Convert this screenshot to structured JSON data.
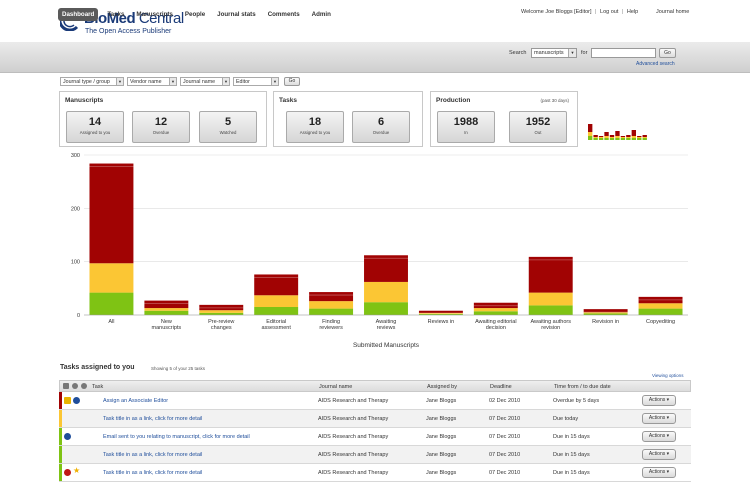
{
  "header": {
    "brand_bold": "BioMed",
    "brand_light": " Central",
    "tagline": "The Open Access Publisher",
    "welcome": "Welcome Joe Bloggs [Editor]",
    "logout": "Log out",
    "help": "Help",
    "separator": "|",
    "journal_home": "Journal home"
  },
  "nav": {
    "items": [
      "Dashboard",
      "Tasks",
      "Manuscripts",
      "People",
      "Journal stats",
      "Comments",
      "Admin"
    ],
    "active": "Dashboard"
  },
  "search": {
    "label": "Search",
    "scope": "manuscripts",
    "for_label": "for",
    "query": "",
    "go": "Go",
    "advanced": "Advanced search"
  },
  "filters": {
    "items": [
      "Journal type / group",
      "Vendor name",
      "Journal name",
      "Editor"
    ],
    "go": "Go"
  },
  "panels": {
    "manuscripts": {
      "title": "Manuscripts",
      "stats": [
        {
          "value": "14",
          "label": "Assigned to you"
        },
        {
          "value": "12",
          "label": "Overdue"
        },
        {
          "value": "5",
          "label": "Watched"
        }
      ]
    },
    "tasks": {
      "title": "Tasks",
      "stats": [
        {
          "value": "18",
          "label": "Assigned to you"
        },
        {
          "value": "6",
          "label": "Overdue"
        }
      ]
    },
    "production": {
      "title": "Production",
      "note": "(past 30 days)",
      "stats": [
        {
          "value": "1988",
          "label": "In"
        },
        {
          "value": "1952",
          "label": "Out"
        }
      ]
    }
  },
  "colors": {
    "red": "#a10303",
    "yellow": "#fbc634",
    "green": "#7fc314"
  },
  "chart_data": {
    "type": "bar",
    "stacked": true,
    "xlabel": "Submitted Manuscripts",
    "ylim": [
      0,
      300
    ],
    "yticks": [
      0,
      100,
      200,
      300
    ],
    "grid": true,
    "categories": [
      "All",
      "New manuscripts",
      "Pre-review changes",
      "Editorial assessment",
      "Finding reviewers",
      "Awaiting reviews",
      "Reviews in",
      "Awaiting editorial decision",
      "Awaiting authors revision",
      "Revision in",
      "Copyediting"
    ],
    "series": [
      {
        "color": "#7fc314",
        "values": [
          42,
          8,
          4,
          15,
          12,
          24,
          2,
          7,
          18,
          3,
          12
        ]
      },
      {
        "color": "#fbc634",
        "values": [
          55,
          5,
          5,
          22,
          14,
          38,
          2,
          6,
          24,
          2,
          10
        ]
      },
      {
        "color": "#a10303",
        "values": [
          187,
          14,
          10,
          39,
          17,
          50,
          4,
          10,
          67,
          6,
          12
        ]
      }
    ]
  },
  "sparkline_data": {
    "type": "bar",
    "stacked": true,
    "series": [
      {
        "color": "#7fc314",
        "values": [
          4,
          2,
          2,
          2,
          2,
          2,
          2,
          2,
          2,
          2,
          2
        ]
      },
      {
        "color": "#fbc634",
        "values": [
          4,
          1,
          1,
          2,
          1,
          2,
          1,
          1,
          2,
          1,
          1
        ]
      },
      {
        "color": "#a10303",
        "values": [
          8,
          2,
          1,
          4,
          2,
          5,
          1,
          2,
          6,
          1,
          2
        ]
      }
    ]
  },
  "tasks": {
    "title": "Tasks assigned to you",
    "count_note": "Showing 5 of your 25 tasks",
    "viewing_options": "Viewing options",
    "columns": {
      "task": "Task",
      "journal": "Journal name",
      "assigned": "Assigned by",
      "deadline": "Deadline",
      "time": "Time from / to due date"
    },
    "rows": [
      {
        "task": "Assign an Associate Editor",
        "journal": "AIDS Research and Therapy",
        "assigned": "Jane Bloggs",
        "deadline": "02 Dec 2010",
        "time": "Overdue by 5 days",
        "status": "#a10303",
        "icons": [
          "flag",
          "info"
        ],
        "actions": "Actions"
      },
      {
        "task": "Task title in as a link, click for more detail",
        "journal": "AIDS Research and Therapy",
        "assigned": "Jane Bloggs",
        "deadline": "07 Dec 2010",
        "time": "Due today",
        "status": "#fbc634",
        "icons": [],
        "actions": "Actions"
      },
      {
        "task": "Email sent to you relating to manuscript, click for more detail",
        "journal": "AIDS Research and Therapy",
        "assigned": "Jane Bloggs",
        "deadline": "07 Dec 2010",
        "time": "Due in 15 days",
        "status": "#7fc314",
        "icons": [
          "info"
        ],
        "actions": "Actions"
      },
      {
        "task": "Task title in as a link, click for more detail",
        "journal": "AIDS Research and Therapy",
        "assigned": "Jane Bloggs",
        "deadline": "07 Dec 2010",
        "time": "Due in 15 days",
        "status": "#7fc314",
        "icons": [],
        "actions": "Actions"
      },
      {
        "task": "Task title in as a link, click for more detail",
        "journal": "AIDS Research and Therapy",
        "assigned": "Jane Bloggs",
        "deadline": "07 Dec 2010",
        "time": "Due in 15 days",
        "status": "#7fc314",
        "icons": [
          "block",
          "star"
        ],
        "actions": "Actions"
      }
    ]
  }
}
